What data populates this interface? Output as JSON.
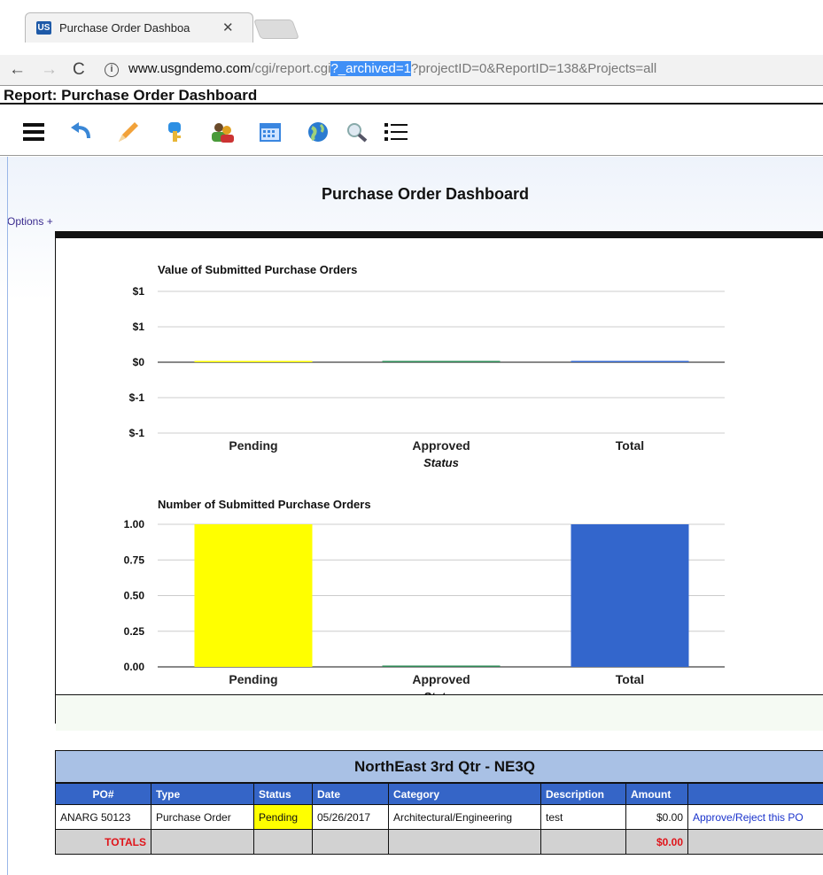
{
  "browser": {
    "tab_title": "Purchase Order Dashboa",
    "tab_icon": "US",
    "url_prefix": "www.usgndemo.com",
    "url_path": "/cgi/report.cgi",
    "url_highlight": "?_archived=1",
    "url_rest": "?projectID=0&ReportID=138&Projects=all"
  },
  "report": {
    "header": "Report: Purchase Order Dashboard",
    "toolbar_icons": [
      "menu-icon",
      "undo-icon",
      "pencil-icon",
      "key-icon",
      "users-icon",
      "calendar-icon",
      "globe-icon",
      "search-icon",
      "list-icon"
    ]
  },
  "dashboard": {
    "title": "Purchase Order Dashboard",
    "options_label": "Options +"
  },
  "chart_data": [
    {
      "type": "bar",
      "title": "Value of Submitted Purchase Orders",
      "xlabel": "Status",
      "categories": [
        "Pending",
        "Approved",
        "Total"
      ],
      "values": [
        0,
        0,
        0
      ],
      "ytick_labels": [
        "$1",
        "$1",
        "$0",
        "$-1",
        "$-1"
      ],
      "colors": [
        "#ffff00",
        "#2e8b57",
        "#3366cc"
      ]
    },
    {
      "type": "bar",
      "title": "Number of Submitted Purchase Orders",
      "xlabel": "Status",
      "categories": [
        "Pending",
        "Approved",
        "Total"
      ],
      "values": [
        1,
        0,
        1
      ],
      "ylim": [
        0,
        1
      ],
      "ytick_labels": [
        "1.00",
        "0.75",
        "0.50",
        "0.25",
        "0.00"
      ],
      "colors": [
        "#ffff00",
        "#2e8b57",
        "#3366cc"
      ]
    }
  ],
  "table": {
    "title": "NorthEast 3rd Qtr - NE3Q",
    "headers": [
      "PO#",
      "Type",
      "Status",
      "Date",
      "Category",
      "Description",
      "Amount",
      ""
    ],
    "row": {
      "po": "ANARG 50123",
      "type": "Purchase Order",
      "status": "Pending",
      "date": "05/26/2017",
      "category": "Architectural/Engineering",
      "description": "test",
      "amount": "$0.00",
      "action": "Approve/Reject this PO"
    },
    "totals": {
      "label": "TOTALS",
      "amount": "$0.00"
    }
  }
}
